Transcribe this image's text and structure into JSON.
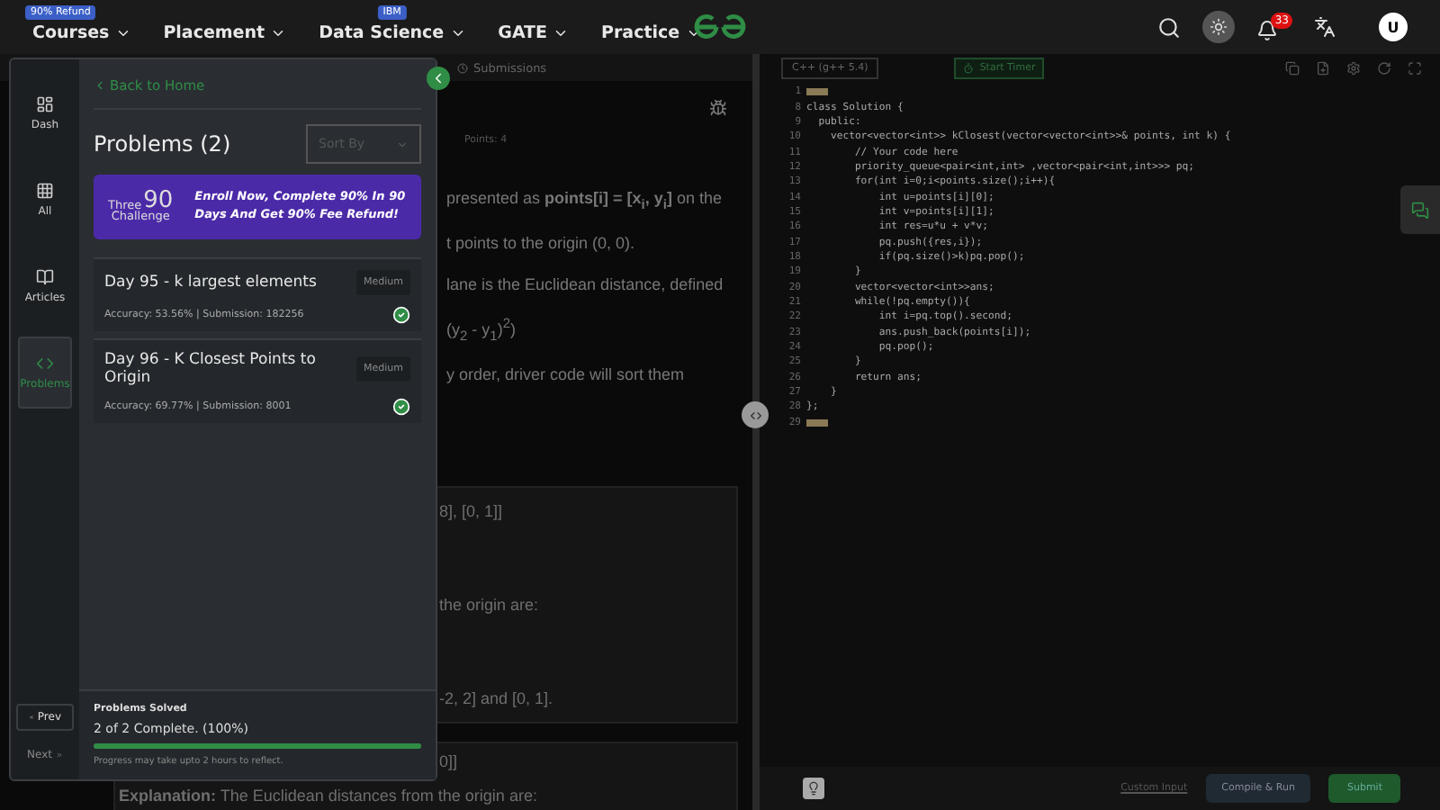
{
  "nav": {
    "items": [
      {
        "label": "Courses",
        "badge": "90% Refund"
      },
      {
        "label": "Placement"
      },
      {
        "label": "Data Science",
        "badge": "IBM"
      },
      {
        "label": "GATE"
      },
      {
        "label": "Practice"
      }
    ],
    "notifications": "33",
    "avatar": "U"
  },
  "problem": {
    "tab": "Submissions",
    "points": "Points: 4",
    "paragraphs": [
      "presented as **points[i] = [x$_{i}$, y$_{i}$]** on the",
      "t points to the origin (0, 0).",
      "lane is the Euclidean distance, defined",
      "(y$_{2}$ - y$_{1}$)$^{2}$)",
      "y order, driver code will sort them"
    ],
    "examples": [
      {
        "lines": [
          "8], [0, 1]]",
          "the origin are:",
          "-2, 2] and [0, 1]."
        ]
      },
      {
        "lines": [
          "0]]"
        ],
        "explanation": "**Explanation:** The Euclidean distances from the origin are:"
      }
    ]
  },
  "rail": {
    "items": [
      {
        "label": "Dash",
        "selected": false
      },
      {
        "label": "All",
        "selected": false
      },
      {
        "label": "Articles",
        "selected": false
      },
      {
        "label": "Problems",
        "selected": true
      }
    ],
    "prev": "Prev",
    "next": "Next"
  },
  "panel": {
    "back": "Back to Home",
    "title": "Problems (2)",
    "sort": {
      "placeholder": "Sort By"
    },
    "banner": {
      "logo_top": "Three",
      "logo_number": "90",
      "logo_bottom": "Challenge",
      "text": "Enroll Now, Complete 90% In 90 Days And Get 90% Fee Refund!"
    },
    "problems": [
      {
        "title": "Day 95 - k largest elements",
        "difficulty": "Medium",
        "stats": "Accuracy: 53.56% | Submission: 182256",
        "solved": true
      },
      {
        "title": "Day 96 - K Closest Points to Origin",
        "difficulty": "Medium",
        "stats": "Accuracy: 69.77% | Submission: 8001",
        "solved": true
      }
    ],
    "progress": {
      "label": "Problems Solved",
      "summary": "2 of 2 Complete. (100%)",
      "level": 1,
      "note": "Progress may take upto 2 hours to reflect."
    }
  },
  "editor": {
    "language": "C++ (g++ 5.4)",
    "timer": "Start Timer",
    "lines": [
      {
        "n": "1",
        "folded": true
      },
      {
        "n": "8",
        "text": "class Solution {"
      },
      {
        "n": "9",
        "text": "  public:"
      },
      {
        "n": "10",
        "text": "    vector<vector<int>> kClosest(vector<vector<int>>& points, int k) {"
      },
      {
        "n": "11",
        "text": "        // Your code here"
      },
      {
        "n": "12",
        "text": "        priority_queue<pair<int,int> ,vector<pair<int,int>>> pq;"
      },
      {
        "n": "13",
        "text": "        for(int i=0;i<points.size();i++){"
      },
      {
        "n": "14",
        "text": "            int u=points[i][0];"
      },
      {
        "n": "15",
        "text": "            int v=points[i][1];"
      },
      {
        "n": "16",
        "text": "            int res=u*u + v*v;"
      },
      {
        "n": "17",
        "text": "            pq.push({res,i});"
      },
      {
        "n": "18",
        "text": "            if(pq.size()>k)pq.pop();"
      },
      {
        "n": "19",
        "text": "        }"
      },
      {
        "n": "20",
        "text": "        vector<vector<int>>ans;"
      },
      {
        "n": "21",
        "text": "        while(!pq.empty()){"
      },
      {
        "n": "22",
        "text": "            int i=pq.top().second;"
      },
      {
        "n": "23",
        "text": "            ans.push_back(points[i]);"
      },
      {
        "n": "24",
        "text": "            pq.pop();"
      },
      {
        "n": "25",
        "text": "        }"
      },
      {
        "n": "26",
        "text": "        return ans;"
      },
      {
        "n": "27",
        "text": "    }"
      },
      {
        "n": "28",
        "text": "};"
      },
      {
        "n": "29",
        "folded": true
      }
    ],
    "custom_input": "Custom Input",
    "compile": "Compile & Run",
    "submit": "Submit"
  }
}
